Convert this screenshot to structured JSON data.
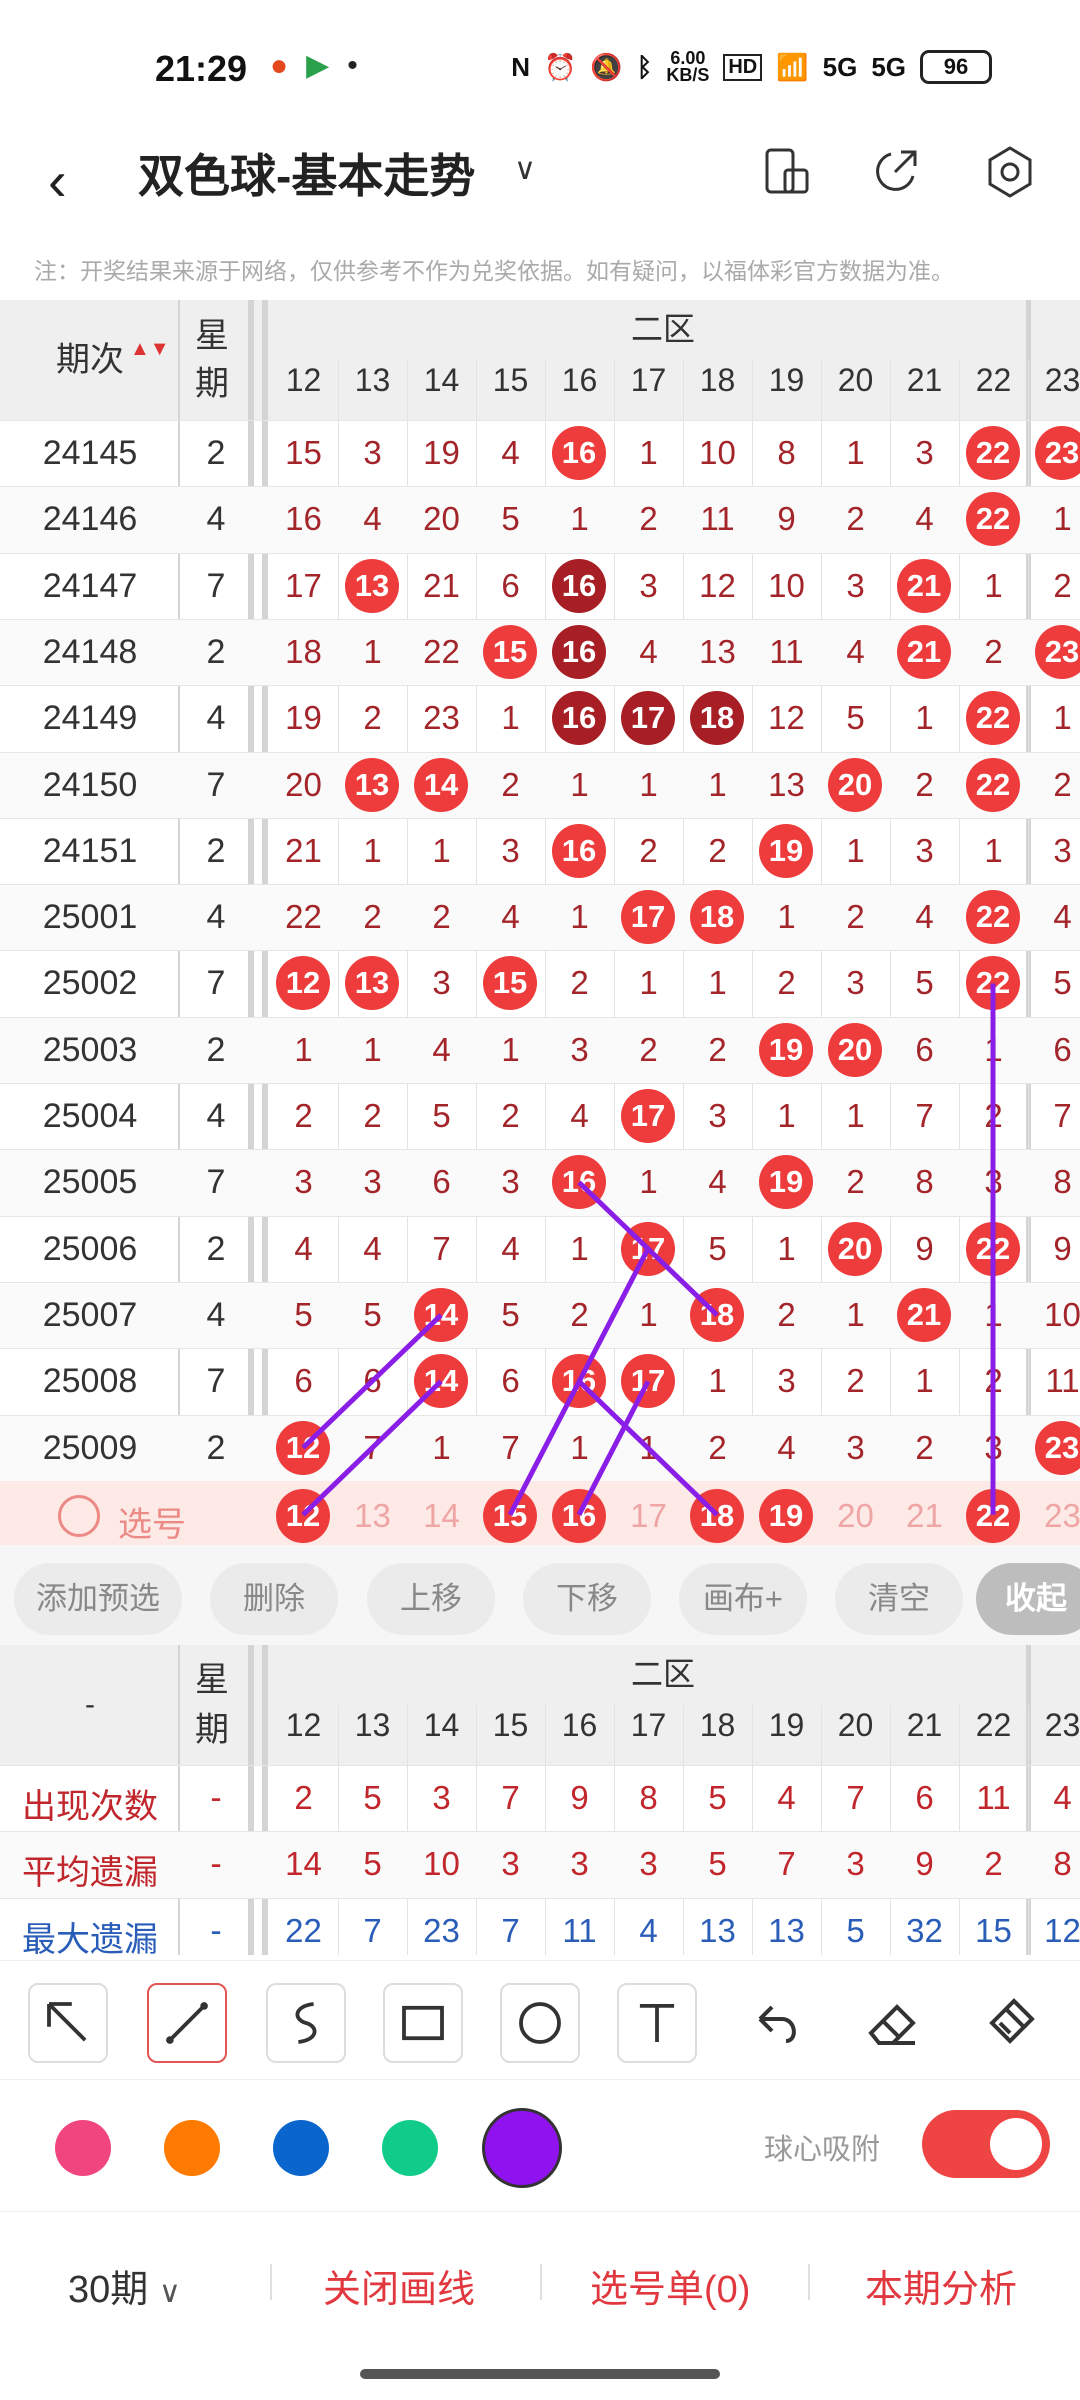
{
  "status": {
    "time": "21:29",
    "speed": "6.00\nKB/S",
    "net1": "5G",
    "net2": "5G",
    "battery": "96"
  },
  "header": {
    "title": "双色球-基本走势"
  },
  "notice": "注：开奖结果来源于网络，仅供参考不作为兑奖依据。如有疑问，以福体彩官方数据为准。",
  "table": {
    "period_label": "期次",
    "week_label": "星期",
    "zone_label": "二区",
    "columns": [
      "12",
      "13",
      "14",
      "15",
      "16",
      "17",
      "18",
      "19",
      "20",
      "21",
      "22",
      "23"
    ],
    "rows": [
      {
        "period": "24145",
        "week": "2",
        "cells": [
          "15",
          "3",
          "19",
          "4",
          "16",
          "1",
          "10",
          "8",
          "1",
          "3",
          "22",
          "23"
        ]
      },
      {
        "period": "24146",
        "week": "4",
        "cells": [
          "16",
          "4",
          "20",
          "5",
          "1",
          "2",
          "11",
          "9",
          "2",
          "4",
          "22",
          "1"
        ]
      },
      {
        "period": "24147",
        "week": "7",
        "cells": [
          "17",
          "13",
          "21",
          "6",
          "16",
          "3",
          "12",
          "10",
          "3",
          "21",
          "1",
          "2"
        ]
      },
      {
        "period": "24148",
        "week": "2",
        "cells": [
          "18",
          "1",
          "22",
          "15",
          "16",
          "4",
          "13",
          "11",
          "4",
          "21",
          "2",
          "23"
        ]
      },
      {
        "period": "24149",
        "week": "4",
        "cells": [
          "19",
          "2",
          "23",
          "1",
          "16",
          "17",
          "18",
          "12",
          "5",
          "1",
          "22",
          "1"
        ]
      },
      {
        "period": "24150",
        "week": "7",
        "cells": [
          "20",
          "13",
          "14",
          "2",
          "1",
          "1",
          "1",
          "13",
          "20",
          "2",
          "22",
          "2"
        ]
      },
      {
        "period": "24151",
        "week": "2",
        "cells": [
          "21",
          "1",
          "1",
          "3",
          "16",
          "2",
          "2",
          "19",
          "1",
          "3",
          "1",
          "3"
        ]
      },
      {
        "period": "25001",
        "week": "4",
        "cells": [
          "22",
          "2",
          "2",
          "4",
          "1",
          "17",
          "18",
          "1",
          "2",
          "4",
          "22",
          "4"
        ]
      },
      {
        "period": "25002",
        "week": "7",
        "cells": [
          "12",
          "13",
          "3",
          "15",
          "2",
          "1",
          "1",
          "2",
          "3",
          "5",
          "22",
          "5"
        ]
      },
      {
        "period": "25003",
        "week": "2",
        "cells": [
          "1",
          "1",
          "4",
          "1",
          "3",
          "2",
          "2",
          "19",
          "20",
          "6",
          "1",
          "6"
        ]
      },
      {
        "period": "25004",
        "week": "4",
        "cells": [
          "2",
          "2",
          "5",
          "2",
          "4",
          "17",
          "3",
          "1",
          "1",
          "7",
          "2",
          "7"
        ]
      },
      {
        "period": "25005",
        "week": "7",
        "cells": [
          "3",
          "3",
          "6",
          "3",
          "16",
          "1",
          "4",
          "19",
          "2",
          "8",
          "3",
          "8"
        ]
      },
      {
        "period": "25006",
        "week": "2",
        "cells": [
          "4",
          "4",
          "7",
          "4",
          "1",
          "17",
          "5",
          "1",
          "20",
          "9",
          "22",
          "9"
        ]
      },
      {
        "period": "25007",
        "week": "4",
        "cells": [
          "5",
          "5",
          "14",
          "5",
          "2",
          "1",
          "18",
          "2",
          "1",
          "21",
          "1",
          "10"
        ]
      },
      {
        "period": "25008",
        "week": "7",
        "cells": [
          "6",
          "6",
          "14",
          "6",
          "16",
          "17",
          "1",
          "3",
          "2",
          "1",
          "2",
          "11"
        ]
      },
      {
        "period": "25009",
        "week": "2",
        "cells": [
          "12",
          "7",
          "1",
          "7",
          "1",
          "1",
          "2",
          "4",
          "3",
          "2",
          "3",
          "23"
        ]
      }
    ],
    "select_label": "选号",
    "select_cells": [
      "12",
      "13",
      "14",
      "15",
      "16",
      "17",
      "18",
      "19",
      "20",
      "21",
      "22",
      "23"
    ]
  },
  "buttons": [
    "添加预选",
    "删除",
    "上移",
    "下移",
    "画布+",
    "清空",
    "收起"
  ],
  "stats": {
    "dash": "-",
    "rows": [
      {
        "label": "出现次数",
        "week": "-",
        "vals": [
          "2",
          "5",
          "3",
          "7",
          "9",
          "8",
          "5",
          "4",
          "7",
          "6",
          "11",
          "4"
        ]
      },
      {
        "label": "平均遗漏",
        "week": "-",
        "vals": [
          "14",
          "5",
          "10",
          "3",
          "3",
          "3",
          "5",
          "7",
          "3",
          "9",
          "2",
          "8"
        ]
      },
      {
        "label": "最大遗漏",
        "week": "-",
        "vals": [
          "22",
          "7",
          "23",
          "7",
          "11",
          "4",
          "13",
          "13",
          "5",
          "32",
          "15",
          "12"
        ]
      }
    ]
  },
  "colors": {
    "pink": "#f0457e",
    "orange": "#ff7a00",
    "blue": "#0a66cc",
    "green": "#11cc88",
    "purple": "#9012ee"
  },
  "snap_label": "球心吸附",
  "bottom": {
    "periods": "30期",
    "close_draw": "关闭画线",
    "pick_list": "选号单(0)",
    "analysis": "本期分析"
  }
}
